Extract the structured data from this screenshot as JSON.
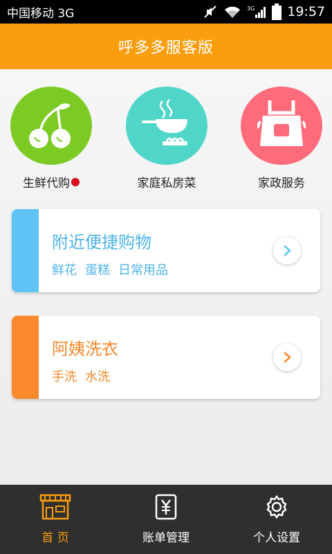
{
  "status_bar": {
    "carrier": "中国移动 3G",
    "network_label": "3G",
    "time": "19:57",
    "icons": [
      "mute-icon",
      "wifi-icon",
      "signal-icon",
      "battery-icon"
    ]
  },
  "header": {
    "title": "呼多多服客版"
  },
  "categories": [
    {
      "label": "生鲜代购",
      "icon": "cherry-icon",
      "color": "#7ccb24",
      "badge": true
    },
    {
      "label": "家庭私房菜",
      "icon": "cooking-pan-icon",
      "color": "#4fd6c8",
      "badge": false
    },
    {
      "label": "家政服务",
      "icon": "apron-icon",
      "color": "#ff6b7a",
      "badge": false
    }
  ],
  "cards": [
    {
      "title": "附近便捷购物",
      "tags": [
        "鲜花",
        "蛋糕",
        "日常用品"
      ],
      "color": "#5fc3f5"
    },
    {
      "title": "阿姨洗衣",
      "tags": [
        "手洗",
        "水洗"
      ],
      "color": "#fb8a2c"
    }
  ],
  "bottom_nav": {
    "items": [
      {
        "label": "首 页",
        "icon": "store-icon",
        "active": true
      },
      {
        "label": "账单管理",
        "icon": "bill-yen-icon",
        "active": false
      },
      {
        "label": "个人设置",
        "icon": "gear-icon",
        "active": false
      }
    ]
  },
  "colors": {
    "accent": "#fa9d0e",
    "nav_bg": "#2f2f2f"
  }
}
